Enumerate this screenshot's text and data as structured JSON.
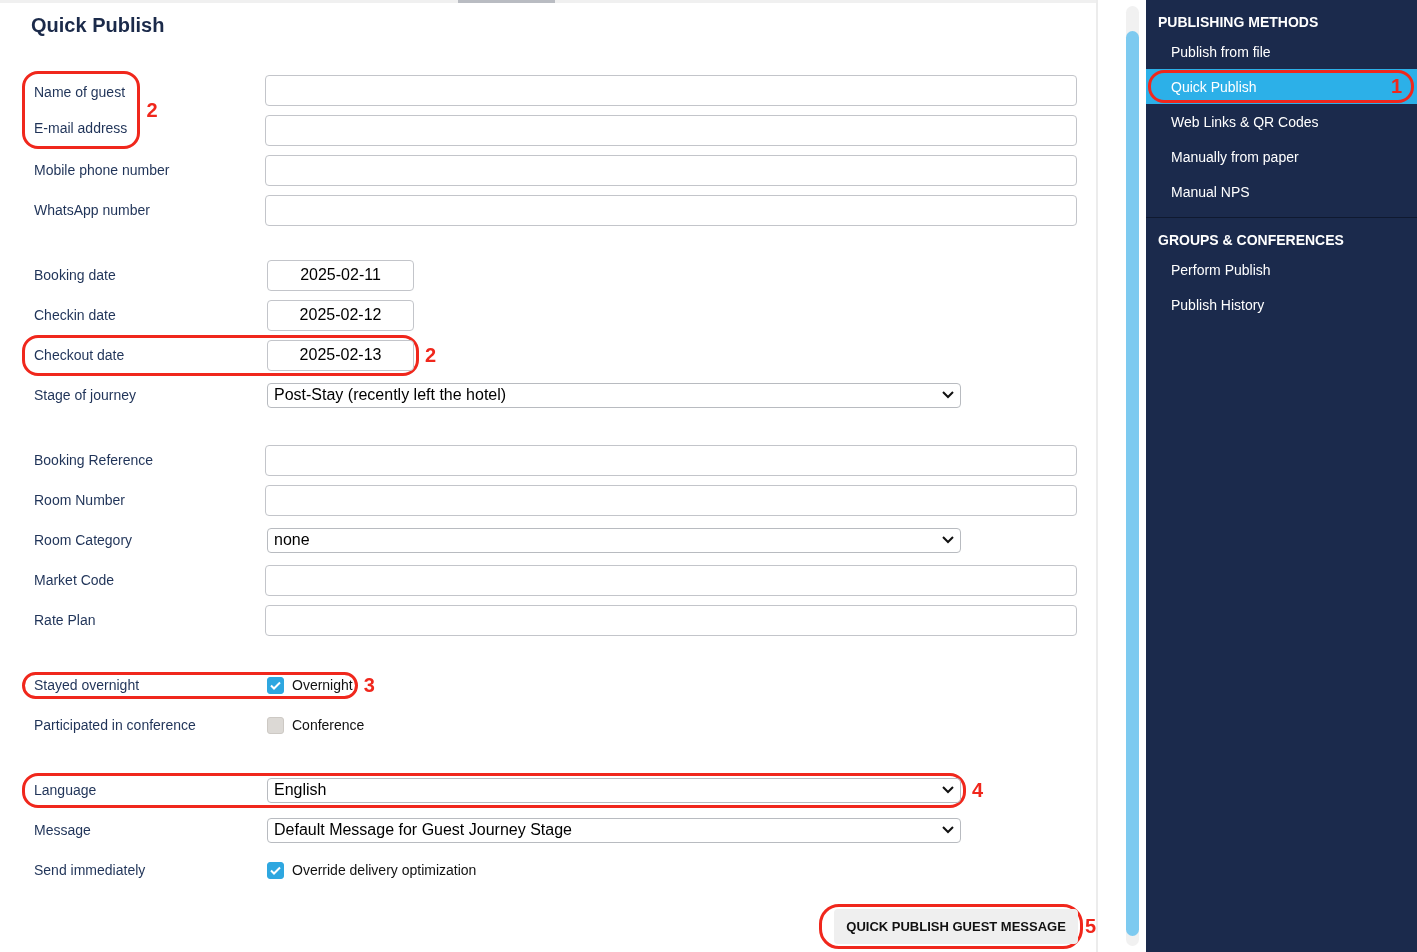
{
  "title": "Quick Publish",
  "sections": [
    {
      "rows": [
        {
          "kind": "pair",
          "callout": "2",
          "rows": [
            {
              "kind": "text",
              "label": "Name of guest"
            },
            {
              "kind": "text",
              "label": "E-mail address"
            }
          ]
        },
        {
          "kind": "text",
          "label": "Mobile phone number"
        },
        {
          "kind": "text",
          "label": "WhatsApp number"
        }
      ]
    },
    {
      "rows": [
        {
          "kind": "date",
          "label": "Booking date",
          "value": "2025-02-11"
        },
        {
          "kind": "date",
          "label": "Checkin date",
          "value": "2025-02-12"
        },
        {
          "kind": "date",
          "label": "Checkout date",
          "value": "2025-02-13",
          "callout": "2"
        },
        {
          "kind": "select",
          "label": "Stage of journey",
          "value": "Post-Stay (recently left the hotel)"
        }
      ]
    },
    {
      "rows": [
        {
          "kind": "text",
          "label": "Booking Reference"
        },
        {
          "kind": "text",
          "label": "Room Number"
        },
        {
          "kind": "select",
          "label": "Room Category",
          "value": "none"
        },
        {
          "kind": "text",
          "label": "Market Code"
        },
        {
          "kind": "text",
          "label": "Rate Plan"
        }
      ]
    },
    {
      "rows": [
        {
          "kind": "checkbox",
          "label": "Stayed overnight",
          "option": "Overnight",
          "checked": true,
          "callout": "3"
        },
        {
          "kind": "checkbox",
          "label": "Participated in conference",
          "option": "Conference",
          "checked": false
        }
      ]
    },
    {
      "rows": [
        {
          "kind": "select",
          "label": "Language",
          "value": "English",
          "callout": "4"
        },
        {
          "kind": "select",
          "label": "Message",
          "value": "Default Message for Guest Journey Stage"
        },
        {
          "kind": "checkbox",
          "label": "Send immediately",
          "option": "Override delivery optimization",
          "checked": true
        }
      ]
    }
  ],
  "submit": {
    "label": "QUICK PUBLISH GUEST MESSAGE",
    "callout": "5"
  },
  "sidebar": [
    {
      "heading": "PUBLISHING METHODS",
      "items": [
        {
          "label": "Publish from file",
          "selected": false
        },
        {
          "label": "Quick Publish",
          "selected": true,
          "callout": "1"
        },
        {
          "label": "Web Links & QR Codes",
          "selected": false
        },
        {
          "label": "Manually from paper",
          "selected": false
        },
        {
          "label": "Manual NPS",
          "selected": false
        }
      ]
    },
    {
      "heading": "GROUPS & CONFERENCES",
      "items": [
        {
          "label": "Perform Publish",
          "selected": false
        },
        {
          "label": "Publish History",
          "selected": false
        }
      ]
    }
  ]
}
